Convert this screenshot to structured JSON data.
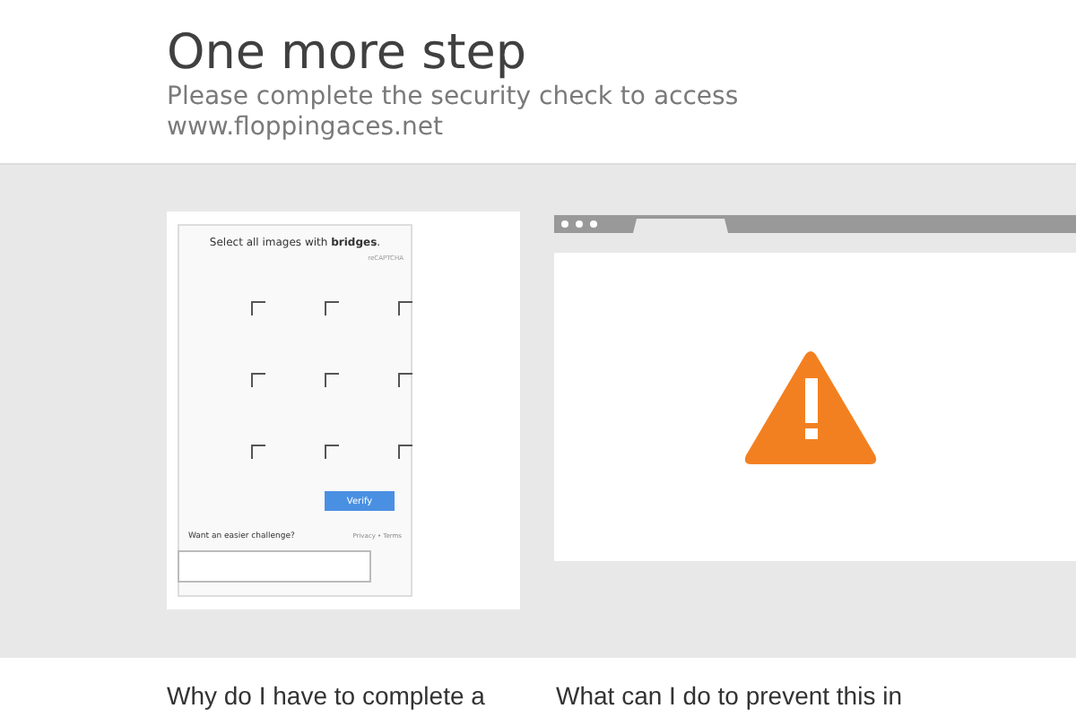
{
  "header": {
    "title": "One more step",
    "subtitle": "Please complete the security check to access",
    "domain": "www.floppingaces.net"
  },
  "captcha": {
    "instruction": "Select all images with **bridges**.",
    "brand": "reCAPTCHA",
    "verify": "Verify",
    "easier": "Want an easier challenge?",
    "links": "Privacy • Terms"
  },
  "faq": [
    {
      "question": "Why do I have to complete a"
    },
    {
      "question": "What can I do to prevent this in"
    }
  ]
}
